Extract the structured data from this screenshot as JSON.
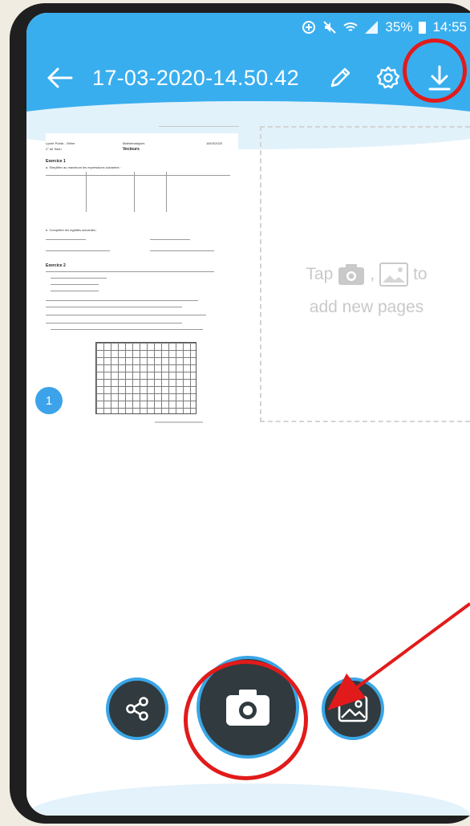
{
  "status_bar": {
    "battery": "35%",
    "time": "14:55",
    "icons": [
      "data-saver-icon",
      "mute-icon",
      "wifi-icon",
      "signal-icon",
      "battery-icon"
    ]
  },
  "toolbar": {
    "back_icon": "arrow-left-icon",
    "title": "17-03-2020-14.50.42",
    "actions": [
      "pencil-icon",
      "gear-icon",
      "download-icon"
    ]
  },
  "document": {
    "page_number": "1",
    "thumbnail": {
      "header_left": "Lycée Public - Wiher",
      "header_center": "Mathématiques",
      "header_right": "16/03/2020",
      "class_line": "2° de Sach",
      "topic": "Vecteurs",
      "exercise_1": "Exercice 1",
      "exercise_1_a": "a. Simplifier au maximum les expressions suivantes :",
      "exercise_1_b": "b. Compléter les égalités suivantes :",
      "exercise_2": "Exercice 2"
    }
  },
  "add_pages_hint": {
    "prefix": "Tap",
    "separator": ",",
    "suffix": "to",
    "line2": "add new pages",
    "icons": [
      "camera-icon",
      "gallery-icon"
    ]
  },
  "bottom_actions": [
    "share-icon",
    "camera-icon",
    "gallery-icon"
  ],
  "colors": {
    "toolbar": "#39aeee",
    "fab": "#303a3f",
    "fab_ring": "#3aa6e6",
    "badge": "#3ca3ea",
    "annotation": "#e11b1b"
  }
}
